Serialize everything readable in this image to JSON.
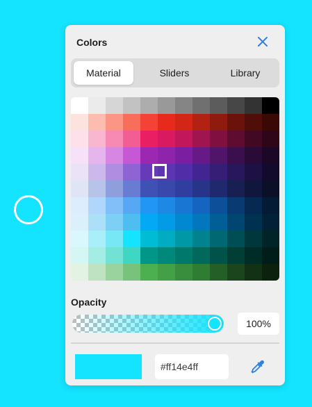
{
  "background_color": "#14e4ff",
  "accent_color": "#2f7fe0",
  "panel": {
    "title": "Colors",
    "close_icon": "close-icon",
    "tabs": [
      {
        "label": "Material",
        "active": true
      },
      {
        "label": "Sliders",
        "active": false
      },
      {
        "label": "Library",
        "active": false
      }
    ]
  },
  "palette": {
    "rows": [
      [
        "#ffffff",
        "#ebebeb",
        "#d6d6d6",
        "#c2c2c2",
        "#adadad",
        "#999999",
        "#858585",
        "#707070",
        "#5c5c5c",
        "#474747",
        "#333333",
        "#000000"
      ],
      [
        "#fde3dd",
        "#fcbcb0",
        "#fb9685",
        "#f86e5a",
        "#f44336",
        "#e82a1c",
        "#d32616",
        "#b22213",
        "#8f1a0e",
        "#6b130a",
        "#4f0e08",
        "#3a0905"
      ],
      [
        "#fde0ea",
        "#f9b6cf",
        "#f68ab2",
        "#f25e94",
        "#e91e63",
        "#d81b60",
        "#c2185b",
        "#a01450",
        "#7f1040",
        "#5e0c30",
        "#430922",
        "#2e0617"
      ],
      [
        "#f6e1f8",
        "#e7b5ed",
        "#d787e2",
        "#c658d6",
        "#9c27b0",
        "#8e24aa",
        "#7b1fa2",
        "#651a85",
        "#501469",
        "#3b0f4e",
        "#2a0b38",
        "#1c0726"
      ],
      [
        "#ebe2f7",
        "#cdb8ec",
        "#af8de0",
        "#9063d4",
        "#673ab7",
        "#5e35b1",
        "#512da8",
        "#432592",
        "#361e77",
        "#28175b",
        "#1d1042",
        "#130b2c"
      ],
      [
        "#e0e5f5",
        "#b8c3ea",
        "#8f9fde",
        "#677cd2",
        "#3f51b5",
        "#3949ab",
        "#303f9f",
        "#283487",
        "#20296e",
        "#181f53",
        "#11163c",
        "#0b0f28"
      ],
      [
        "#dcedfd",
        "#b0d7fb",
        "#82bff8",
        "#56a8f5",
        "#2196f3",
        "#1e88e5",
        "#1976d2",
        "#1565c0",
        "#0d4f98",
        "#093b72",
        "#062951",
        "#041b36"
      ],
      [
        "#daf1fc",
        "#ace0f8",
        "#7dcff5",
        "#4ebef1",
        "#03a9f4",
        "#039be5",
        "#0288d1",
        "#0277bd",
        "#015e96",
        "#014670",
        "#013150",
        "#002136"
      ],
      [
        "#d9f8fd",
        "#a8eff9",
        "#77e6f5",
        "#14e4ff",
        "#00bcd4",
        "#00acc1",
        "#0097a7",
        "#00838f",
        "#006872",
        "#004e55",
        "#00373c",
        "#002428"
      ],
      [
        "#d5f7f3",
        "#a4ede4",
        "#72e2d4",
        "#3fd7c4",
        "#009688",
        "#00897b",
        "#00796b",
        "#00695c",
        "#005349",
        "#003e36",
        "#002c27",
        "#001d1a"
      ],
      [
        "#e2f2e3",
        "#bfe3c1",
        "#9bd39e",
        "#77c37b",
        "#4caf50",
        "#43a047",
        "#388e3c",
        "#2e7d32",
        "#245f27",
        "#1b461d",
        "#133215",
        "#0c210e"
      ]
    ],
    "selected": "#14e4ff"
  },
  "opacity": {
    "label": "Opacity",
    "value_text": "100%",
    "value_fraction": 1.0
  },
  "current_color": {
    "swatch_color": "#14e4ff",
    "hex_text": "#ff14e4ff"
  },
  "eyedropper_icon": "eyedropper-icon"
}
